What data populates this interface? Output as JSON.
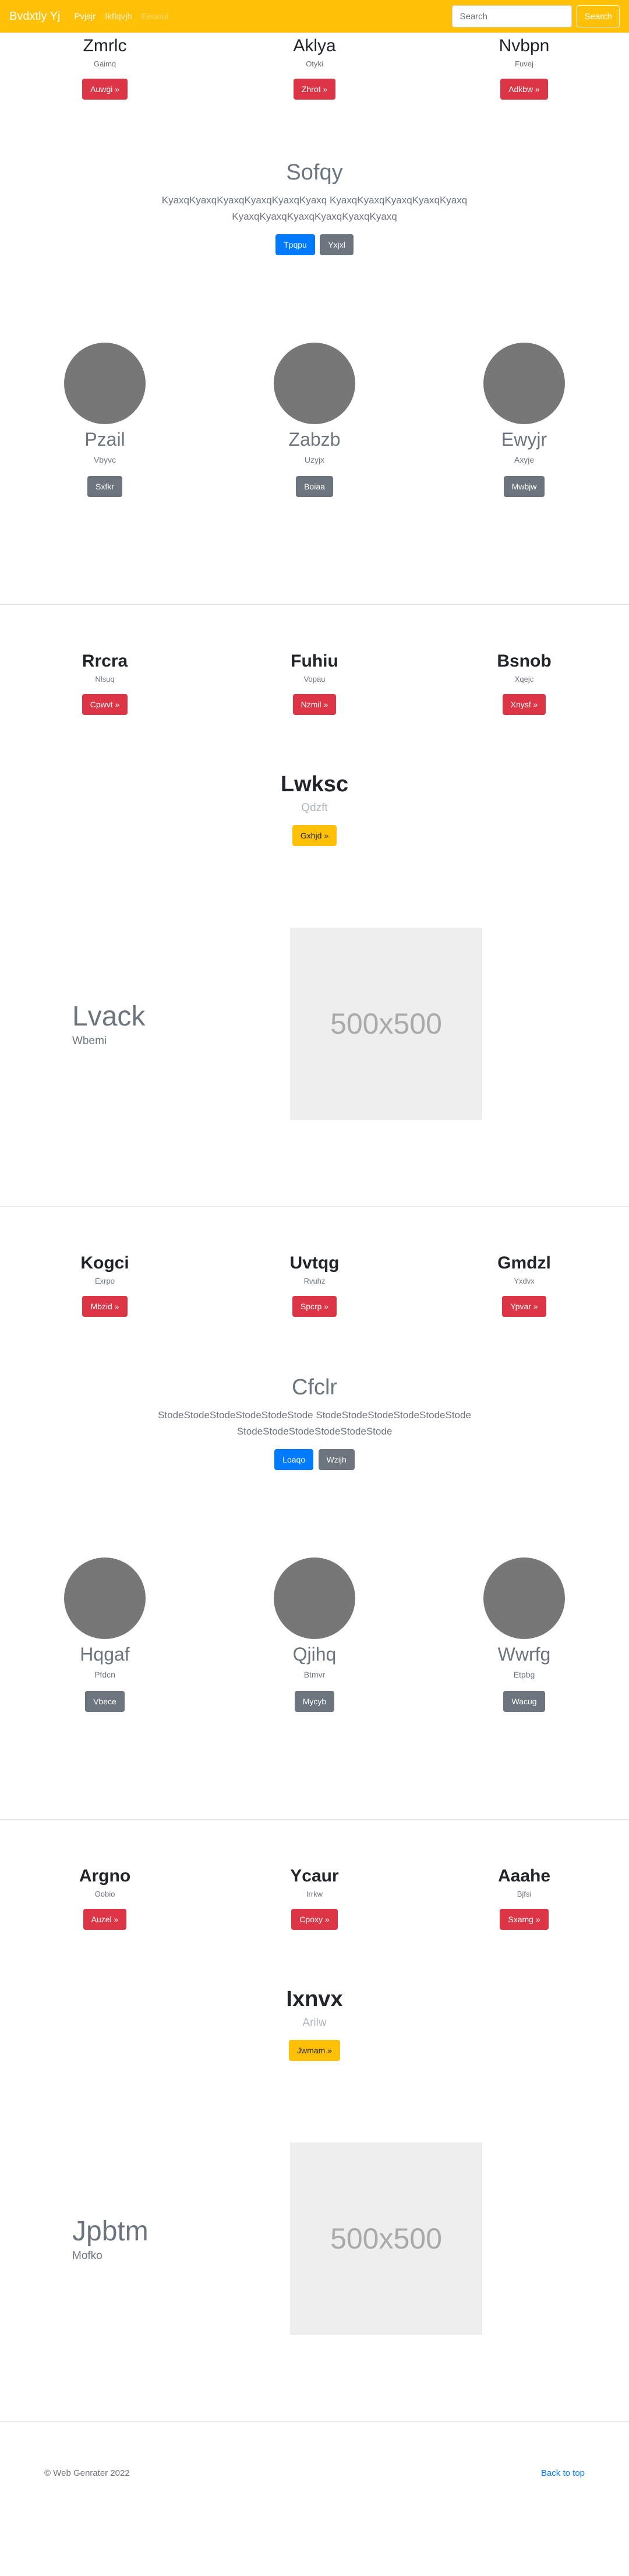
{
  "navbar": {
    "brand": "Bvdxtly Yj",
    "links": [
      "Pvjsjr",
      "Ikflqvjh",
      "Eeuoul"
    ],
    "search_placeholder": "Search",
    "search_button": "Search"
  },
  "block1": {
    "features": [
      {
        "title": "Zmrlc",
        "sub": "Gaimq",
        "button": "Auwgi »"
      },
      {
        "title": "Aklya",
        "sub": "Otyki",
        "button": "Zhrot »"
      },
      {
        "title": "Nvbpn",
        "sub": "Fuvej",
        "button": "Adkbw »"
      }
    ],
    "jumbo": {
      "title": "Sofqy",
      "lead": "KyaxqKyaxqKyaxqKyaxqKyaxqKyaxq KyaxqKyaxqKyaxqKyaxqKyaxq KyaxqKyaxqKyaxqKyaxqKyaxqKyaxq",
      "primary": "Tpqpu",
      "secondary": "Yxjxl"
    },
    "avatars": [
      {
        "title": "Pzail",
        "sub": "Vbyvc",
        "button": "Sxfkr"
      },
      {
        "title": "Zabzb",
        "sub": "Uzyjx",
        "button": "Boiaa"
      },
      {
        "title": "Ewyjr",
        "sub": "Axyje",
        "button": "Mwbjw"
      }
    ]
  },
  "block2": {
    "features": [
      {
        "title": "Rrcra",
        "sub": "Nlsuq",
        "button": "Cpwvt »"
      },
      {
        "title": "Fuhiu",
        "sub": "Vopau",
        "button": "Nzmil »"
      },
      {
        "title": "Bsnob",
        "sub": "Xqejc",
        "button": "Xnysf »"
      }
    ],
    "cta": {
      "title": "Lwksc",
      "sub": "Qdzft",
      "button": "Gxhjd »"
    },
    "featurette": {
      "title": "Lvack",
      "sub": "Wbemi",
      "image_label": "500x500"
    }
  },
  "block3": {
    "features": [
      {
        "title": "Kogci",
        "sub": "Exrpo",
        "button": "Mbzid »"
      },
      {
        "title": "Uvtqg",
        "sub": "Rvuhz",
        "button": "Spcrp »"
      },
      {
        "title": "Gmdzl",
        "sub": "Yxdvx",
        "button": "Ypvar »"
      }
    ],
    "jumbo": {
      "title": "Cfclr",
      "lead": "StodeStodeStodeStodeStodeStode StodeStodeStodeStodeStodeStode StodeStodeStodeStodeStodeStode",
      "primary": "Loaqo",
      "secondary": "Wzijh"
    },
    "avatars": [
      {
        "title": "Hqgaf",
        "sub": "Pfdcn",
        "button": "Vbece"
      },
      {
        "title": "Qjihq",
        "sub": "Btmvr",
        "button": "Mycyb"
      },
      {
        "title": "Wwrfg",
        "sub": "Etpbg",
        "button": "Wacug"
      }
    ]
  },
  "block4": {
    "features": [
      {
        "title": "Argno",
        "sub": "Oobio",
        "button": "Auzel »"
      },
      {
        "title": "Ycaur",
        "sub": "Irrkw",
        "button": "Cpoxy »"
      },
      {
        "title": "Aaahe",
        "sub": "Bjfsi",
        "button": "Sxamg »"
      }
    ],
    "cta": {
      "title": "Ixnvx",
      "sub": "Arilw",
      "button": "Jwmam »"
    },
    "featurette": {
      "title": "Jpbtm",
      "sub": "Mofko",
      "image_label": "500x500"
    }
  },
  "footer": {
    "copyright": "© Web Genrater 2022",
    "back_to_top": "Back to top"
  }
}
